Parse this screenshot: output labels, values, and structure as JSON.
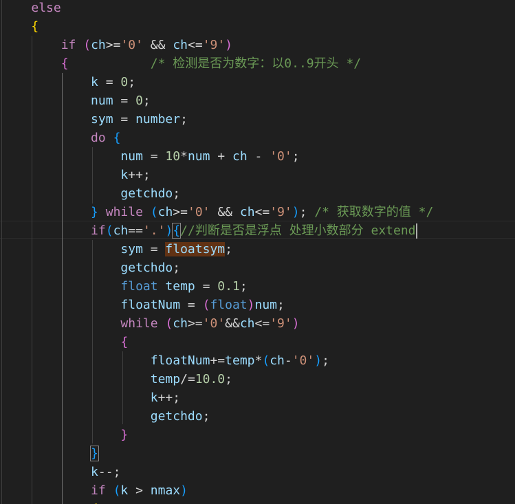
{
  "editor": {
    "lines": [
      [
        {
          "t": "    ",
          "c": "plain"
        },
        {
          "t": "else",
          "c": "kw-ctrl"
        }
      ],
      [
        {
          "t": "    ",
          "c": "plain"
        },
        {
          "t": "{",
          "c": "br1"
        }
      ],
      [
        {
          "t": "        ",
          "c": "plain"
        },
        {
          "t": "if",
          "c": "kw-ctrl"
        },
        {
          "t": " ",
          "c": "plain"
        },
        {
          "t": "(",
          "c": "br2"
        },
        {
          "t": "ch",
          "c": "var"
        },
        {
          "t": ">=",
          "c": "op"
        },
        {
          "t": "'0'",
          "c": "str"
        },
        {
          "t": " && ",
          "c": "op"
        },
        {
          "t": "ch",
          "c": "var"
        },
        {
          "t": "<=",
          "c": "op"
        },
        {
          "t": "'9'",
          "c": "str"
        },
        {
          "t": ")",
          "c": "br2"
        }
      ],
      [
        {
          "t": "        ",
          "c": "plain"
        },
        {
          "t": "{",
          "c": "br2"
        },
        {
          "t": "           ",
          "c": "plain"
        },
        {
          "t": "/* 检测是否为数字：以0..9开头 */",
          "c": "cmt"
        }
      ],
      [
        {
          "t": "            ",
          "c": "plain"
        },
        {
          "t": "k",
          "c": "var"
        },
        {
          "t": " = ",
          "c": "op"
        },
        {
          "t": "0",
          "c": "num"
        },
        {
          "t": ";",
          "c": "op"
        }
      ],
      [
        {
          "t": "            ",
          "c": "plain"
        },
        {
          "t": "num",
          "c": "var"
        },
        {
          "t": " = ",
          "c": "op"
        },
        {
          "t": "0",
          "c": "num"
        },
        {
          "t": ";",
          "c": "op"
        }
      ],
      [
        {
          "t": "            ",
          "c": "plain"
        },
        {
          "t": "sym",
          "c": "var"
        },
        {
          "t": " = ",
          "c": "op"
        },
        {
          "t": "number",
          "c": "var"
        },
        {
          "t": ";",
          "c": "op"
        }
      ],
      [
        {
          "t": "            ",
          "c": "plain"
        },
        {
          "t": "do",
          "c": "kw-ctrl"
        },
        {
          "t": " ",
          "c": "plain"
        },
        {
          "t": "{",
          "c": "br3"
        }
      ],
      [
        {
          "t": "                ",
          "c": "plain"
        },
        {
          "t": "num",
          "c": "var"
        },
        {
          "t": " = ",
          "c": "op"
        },
        {
          "t": "10",
          "c": "num"
        },
        {
          "t": "*",
          "c": "op"
        },
        {
          "t": "num",
          "c": "var"
        },
        {
          "t": " + ",
          "c": "op"
        },
        {
          "t": "ch",
          "c": "var"
        },
        {
          "t": " - ",
          "c": "op"
        },
        {
          "t": "'0'",
          "c": "str"
        },
        {
          "t": ";",
          "c": "op"
        }
      ],
      [
        {
          "t": "                ",
          "c": "plain"
        },
        {
          "t": "k",
          "c": "var"
        },
        {
          "t": "++;",
          "c": "op"
        }
      ],
      [
        {
          "t": "                ",
          "c": "plain"
        },
        {
          "t": "getchdo",
          "c": "var"
        },
        {
          "t": ";",
          "c": "op"
        }
      ],
      [
        {
          "t": "            ",
          "c": "plain"
        },
        {
          "t": "}",
          "c": "br3"
        },
        {
          "t": " ",
          "c": "plain"
        },
        {
          "t": "while",
          "c": "kw-ctrl"
        },
        {
          "t": " ",
          "c": "plain"
        },
        {
          "t": "(",
          "c": "br3"
        },
        {
          "t": "ch",
          "c": "var"
        },
        {
          "t": ">=",
          "c": "op"
        },
        {
          "t": "'0'",
          "c": "str"
        },
        {
          "t": " && ",
          "c": "op"
        },
        {
          "t": "ch",
          "c": "var"
        },
        {
          "t": "<=",
          "c": "op"
        },
        {
          "t": "'9'",
          "c": "str"
        },
        {
          "t": ")",
          "c": "br3"
        },
        {
          "t": "; ",
          "c": "op"
        },
        {
          "t": "/* 获取数字的值 */",
          "c": "cmt"
        }
      ],
      [
        {
          "t": "            ",
          "c": "plain"
        },
        {
          "t": "if",
          "c": "kw-ctrl"
        },
        {
          "t": "(",
          "c": "br3"
        },
        {
          "t": "ch",
          "c": "var"
        },
        {
          "t": "==",
          "c": "op"
        },
        {
          "t": "'.'",
          "c": "str"
        },
        {
          "t": ")",
          "c": "br3"
        },
        {
          "t": "{",
          "c": "br3",
          "m": true
        },
        {
          "t": "//判断是否是浮点 处理小数部分 extend",
          "c": "cmt"
        },
        {
          "t": "",
          "c": "caret"
        }
      ],
      [
        {
          "t": "                ",
          "c": "plain"
        },
        {
          "t": "sym",
          "c": "var"
        },
        {
          "t": " = ",
          "c": "op"
        },
        {
          "t": "floatsym",
          "c": "var",
          "h": true
        },
        {
          "t": ";",
          "c": "op"
        }
      ],
      [
        {
          "t": "                ",
          "c": "plain"
        },
        {
          "t": "getchdo",
          "c": "var"
        },
        {
          "t": ";",
          "c": "op"
        }
      ],
      [
        {
          "t": "                ",
          "c": "plain"
        },
        {
          "t": "float",
          "c": "kw"
        },
        {
          "t": " ",
          "c": "plain"
        },
        {
          "t": "temp",
          "c": "var"
        },
        {
          "t": " = ",
          "c": "op"
        },
        {
          "t": "0.1",
          "c": "num"
        },
        {
          "t": ";",
          "c": "op"
        }
      ],
      [
        {
          "t": "                ",
          "c": "plain"
        },
        {
          "t": "floatNum",
          "c": "var"
        },
        {
          "t": " = ",
          "c": "op"
        },
        {
          "t": "(",
          "c": "br2"
        },
        {
          "t": "float",
          "c": "kw"
        },
        {
          "t": ")",
          "c": "br2"
        },
        {
          "t": "num",
          "c": "var"
        },
        {
          "t": ";",
          "c": "op"
        }
      ],
      [
        {
          "t": "                ",
          "c": "plain"
        },
        {
          "t": "while",
          "c": "kw-ctrl"
        },
        {
          "t": " ",
          "c": "plain"
        },
        {
          "t": "(",
          "c": "br2"
        },
        {
          "t": "ch",
          "c": "var"
        },
        {
          "t": ">=",
          "c": "op"
        },
        {
          "t": "'0'",
          "c": "str"
        },
        {
          "t": "&&",
          "c": "op"
        },
        {
          "t": "ch",
          "c": "var"
        },
        {
          "t": "<=",
          "c": "op"
        },
        {
          "t": "'9'",
          "c": "str"
        },
        {
          "t": ")",
          "c": "br2"
        }
      ],
      [
        {
          "t": "                ",
          "c": "plain"
        },
        {
          "t": "{",
          "c": "br2"
        }
      ],
      [
        {
          "t": "                    ",
          "c": "plain"
        },
        {
          "t": "floatNum",
          "c": "var"
        },
        {
          "t": "+=",
          "c": "op"
        },
        {
          "t": "temp",
          "c": "var"
        },
        {
          "t": "*",
          "c": "op"
        },
        {
          "t": "(",
          "c": "br3"
        },
        {
          "t": "ch",
          "c": "var"
        },
        {
          "t": "-",
          "c": "op"
        },
        {
          "t": "'0'",
          "c": "str"
        },
        {
          "t": ")",
          "c": "br3"
        },
        {
          "t": ";",
          "c": "op"
        }
      ],
      [
        {
          "t": "                    ",
          "c": "plain"
        },
        {
          "t": "temp",
          "c": "var"
        },
        {
          "t": "/=",
          "c": "op"
        },
        {
          "t": "10.0",
          "c": "num"
        },
        {
          "t": ";",
          "c": "op"
        }
      ],
      [
        {
          "t": "                    ",
          "c": "plain"
        },
        {
          "t": "k",
          "c": "var"
        },
        {
          "t": "++;",
          "c": "op"
        }
      ],
      [
        {
          "t": "                    ",
          "c": "plain"
        },
        {
          "t": "getchdo",
          "c": "var"
        },
        {
          "t": ";",
          "c": "op"
        }
      ],
      [
        {
          "t": "                ",
          "c": "plain"
        },
        {
          "t": "}",
          "c": "br2"
        }
      ],
      [
        {
          "t": "            ",
          "c": "plain"
        },
        {
          "t": "}",
          "c": "br3",
          "m": true
        }
      ],
      [
        {
          "t": "            ",
          "c": "plain"
        },
        {
          "t": "k",
          "c": "var"
        },
        {
          "t": "--;",
          "c": "op"
        }
      ],
      [
        {
          "t": "            ",
          "c": "plain"
        },
        {
          "t": "if",
          "c": "kw-ctrl"
        },
        {
          "t": " ",
          "c": "plain"
        },
        {
          "t": "(",
          "c": "br3"
        },
        {
          "t": "k",
          "c": "var"
        },
        {
          "t": " > ",
          "c": "op"
        },
        {
          "t": "nmax",
          "c": "var"
        },
        {
          "t": ")",
          "c": "br3"
        }
      ],
      [
        {
          "t": "            ",
          "c": "plain"
        },
        {
          "t": "{",
          "c": "br1"
        }
      ]
    ]
  }
}
